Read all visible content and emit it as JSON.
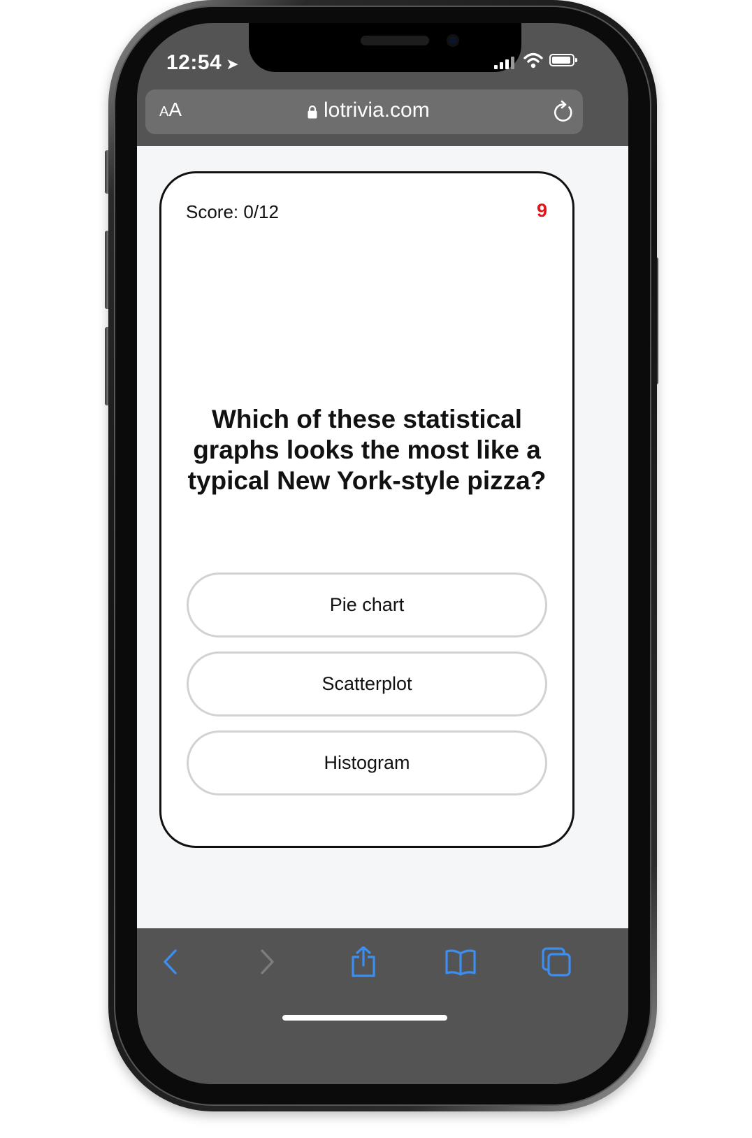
{
  "status_bar": {
    "time": "12:54",
    "location_icon": "location-arrow-icon",
    "signal_icon": "cellular-signal-icon",
    "wifi_icon": "wifi-icon",
    "battery_icon": "battery-icon"
  },
  "browser": {
    "text_size_label_small": "A",
    "text_size_label_large": "A",
    "url": "lotrivia.com",
    "lock_icon": "lock-icon",
    "reload_icon": "reload-icon"
  },
  "quiz": {
    "score": "Score: 0/12",
    "timer": "9",
    "timer_color": "#e2141a",
    "question": "Which of these statistical graphs looks the most like a typical New York-style pizza?",
    "answers": [
      "Pie chart",
      "Scatterplot",
      "Histogram"
    ]
  },
  "toolbar": {
    "back_icon": "back-chevron-icon",
    "forward_icon": "forward-chevron-icon",
    "share_icon": "share-icon",
    "bookmarks_icon": "bookmarks-book-icon",
    "tabs_icon": "tabs-icon",
    "accent_color": "#3c8ef0",
    "disabled_color": "#7d7d7d"
  }
}
